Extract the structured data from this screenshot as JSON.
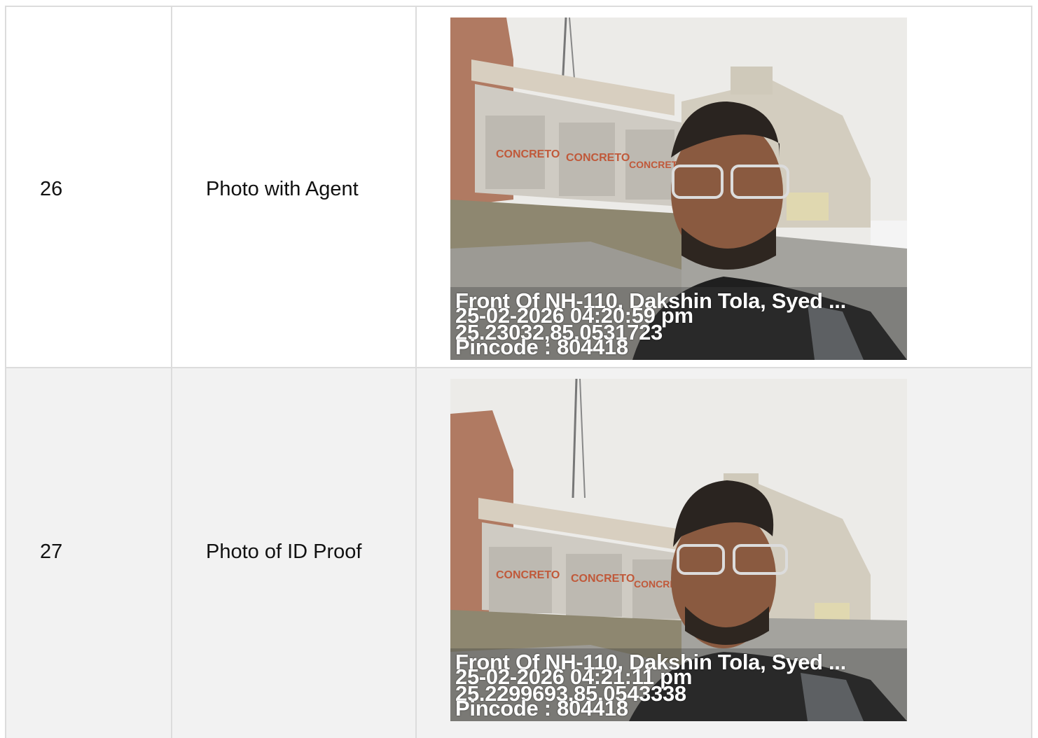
{
  "rows": [
    {
      "number": "26",
      "label": "Photo with Agent",
      "photo": {
        "address": "Front Of NH-110, Dakshin Tola, Syed ...",
        "datetime": "25-02-2026 04:20:59 pm",
        "coords": "25.23032,85.0531723",
        "pincode": "Pincode : 804418"
      }
    },
    {
      "number": "27",
      "label": "Photo of ID Proof",
      "photo": {
        "address": "Front Of NH-110, Dakshin Tola, Syed ...",
        "datetime": "25-02-2026 04:21:11 pm",
        "coords": "25.2299693,85.0543338",
        "pincode": "Pincode : 804418"
      }
    }
  ],
  "colors": {
    "row_alt_bg": "#f2f2f2",
    "border": "#dcdcdc"
  }
}
